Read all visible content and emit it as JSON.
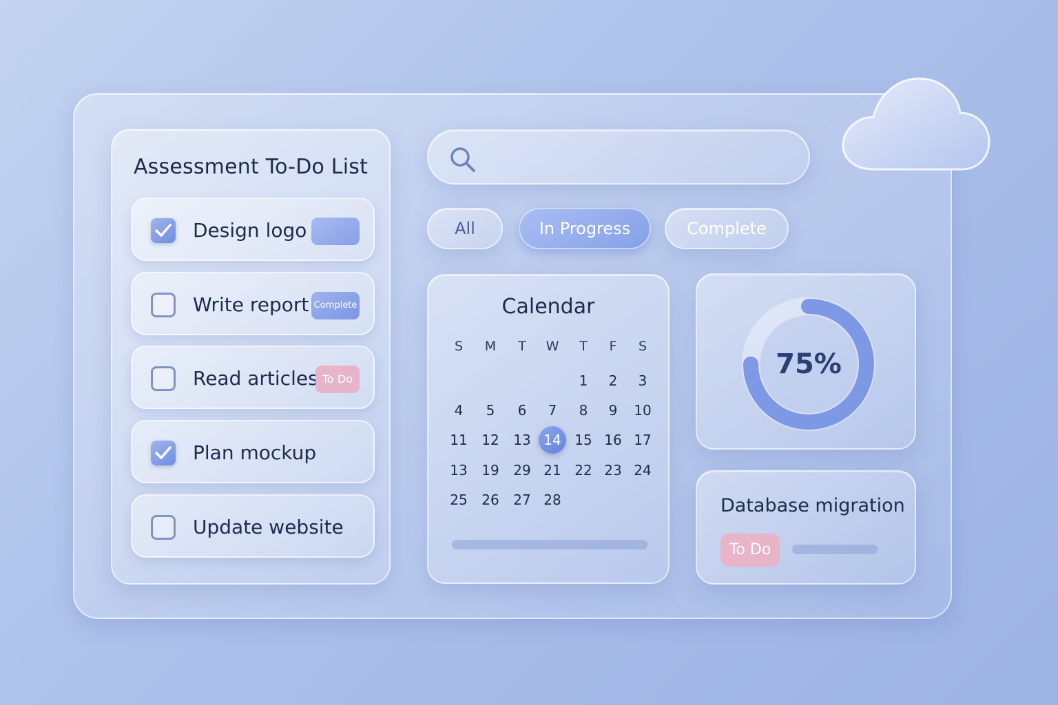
{
  "todo": {
    "title": "Assessment To-Do List",
    "items": [
      {
        "label": "Design logo",
        "checked": true,
        "badge": ""
      },
      {
        "label": "Write report",
        "checked": false,
        "badge": "Complete"
      },
      {
        "label": "Read articles",
        "checked": false,
        "badge": "To Do"
      },
      {
        "label": "Plan mockup",
        "checked": true,
        "badge": ""
      },
      {
        "label": "Update website",
        "checked": false,
        "badge": ""
      }
    ]
  },
  "search": {
    "placeholder": ""
  },
  "filters": {
    "all": "All",
    "in_progress": "In Progress",
    "complete": "Complete"
  },
  "calendar": {
    "title": "Calendar",
    "weekdays": [
      "S",
      "M",
      "T",
      "W",
      "T",
      "F",
      "S"
    ],
    "weeks": [
      [
        "",
        "",
        "",
        "",
        "1",
        "2",
        "3"
      ],
      [
        "4",
        "5",
        "6",
        "7",
        "8",
        "9",
        "10"
      ],
      [
        "11",
        "12",
        "13",
        "14",
        "15",
        "16",
        "17"
      ],
      [
        "13",
        "19",
        "29",
        "21",
        "22",
        "23",
        "24"
      ],
      [
        "25",
        "26",
        "27",
        "28",
        "",
        "",
        ""
      ]
    ],
    "today": "14"
  },
  "progress": {
    "label": "75%",
    "fraction": 0.75
  },
  "db": {
    "title": "Database migration",
    "badge": "To Do"
  },
  "icons": {
    "cloud": "cloud-icon",
    "search": "search-icon",
    "check": "check-icon"
  },
  "colors": {
    "accent": "#7b96e2",
    "todo_badge": "#e7b4c8",
    "text": "#1d2b4c"
  }
}
